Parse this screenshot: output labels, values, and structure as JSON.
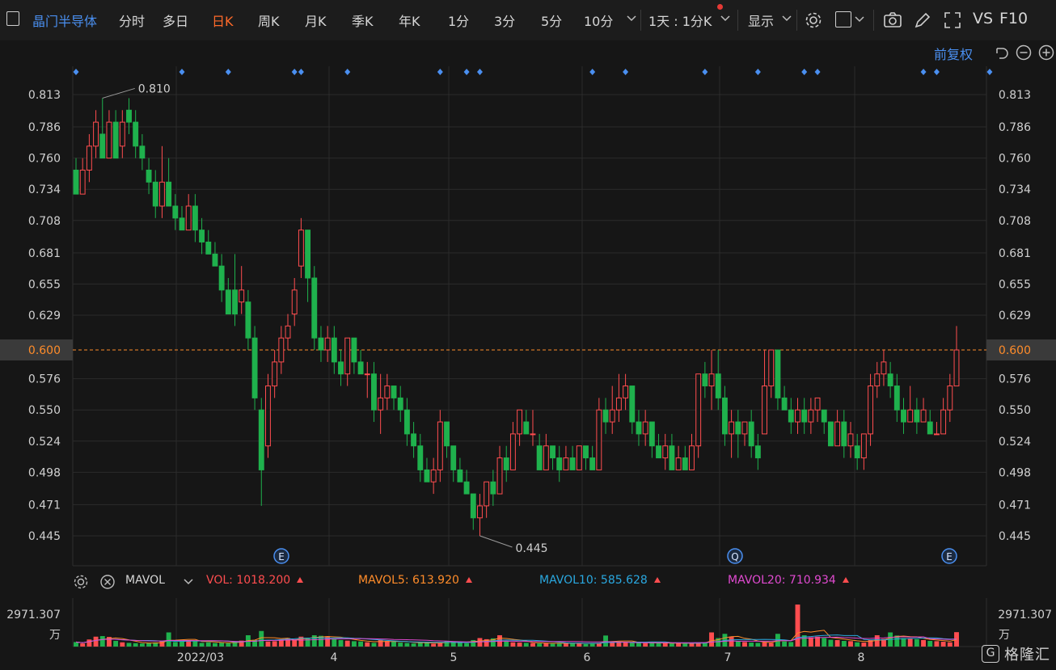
{
  "toolbar": {
    "stock_name": "晶门半导体",
    "periods": [
      "分时",
      "多日",
      "日K",
      "周K",
      "月K",
      "季K",
      "年K",
      "1分",
      "3分",
      "5分",
      "10分"
    ],
    "active_period": "日K",
    "interval_label": "1天 : 1分K",
    "display_label": "显示",
    "vs_label": "VS",
    "f10_label": "F10",
    "adjust_label": "前复权"
  },
  "volume_panel": {
    "indicator_label": "MAVOL",
    "vol": {
      "label": "VOL:",
      "value": "1018.200",
      "color": "#ff4d4f"
    },
    "mavol5": {
      "label": "MAVOL5:",
      "value": "613.920",
      "color": "#ff8c2a"
    },
    "mavol10": {
      "label": "MAVOL10:",
      "value": "585.628",
      "color": "#2aa8e0"
    },
    "mavol20": {
      "label": "MAVOL20:",
      "value": "710.934",
      "color": "#e04ad0"
    },
    "max_label": "2971.307",
    "unit_label": "万"
  },
  "brand": {
    "name": "格隆汇",
    "logo_letter": "G"
  },
  "colors": {
    "up": "#ff4d4f",
    "down": "#1fb14d",
    "grid": "#2b2b2b",
    "price_line": "#ff8c2a",
    "marker": "#4a8ff0",
    "accent": "#ff6a2a",
    "title": "#4a8ff0"
  },
  "chart_data": {
    "type": "candlestick",
    "y_ticks": [
      0.813,
      0.786,
      0.76,
      0.734,
      0.708,
      0.681,
      0.655,
      0.629,
      0.6,
      0.576,
      0.55,
      0.524,
      0.498,
      0.471,
      0.445
    ],
    "y_tick_labels": [
      "0.813",
      "0.786",
      "0.760",
      "0.734",
      "0.708",
      "0.681",
      "0.655",
      "0.629",
      "0.600",
      "0.576",
      "0.550",
      "0.524",
      "0.498",
      "0.471",
      "0.445"
    ],
    "ylim": [
      0.42,
      0.84
    ],
    "current_price": "0.600",
    "x_ticks": [
      "2022/03",
      "4",
      "5",
      "6",
      "7",
      "8"
    ],
    "high_label": "0.810",
    "low_label": "0.445",
    "high_value": 0.81,
    "low_value": 0.445,
    "event_markers": [
      "E",
      "E",
      "Q",
      "E"
    ],
    "candles": [
      [
        0.75,
        0.73,
        0.76,
        0.73
      ],
      [
        0.73,
        0.75,
        0.76,
        0.73
      ],
      [
        0.75,
        0.77,
        0.78,
        0.74
      ],
      [
        0.77,
        0.79,
        0.8,
        0.76
      ],
      [
        0.78,
        0.76,
        0.81,
        0.76
      ],
      [
        0.76,
        0.79,
        0.8,
        0.76
      ],
      [
        0.79,
        0.76,
        0.8,
        0.76
      ],
      [
        0.77,
        0.79,
        0.8,
        0.76
      ],
      [
        0.8,
        0.79,
        0.81,
        0.78
      ],
      [
        0.79,
        0.77,
        0.8,
        0.76
      ],
      [
        0.77,
        0.76,
        0.78,
        0.75
      ],
      [
        0.75,
        0.74,
        0.76,
        0.73
      ],
      [
        0.74,
        0.72,
        0.75,
        0.71
      ],
      [
        0.72,
        0.74,
        0.77,
        0.71
      ],
      [
        0.74,
        0.72,
        0.76,
        0.72
      ],
      [
        0.72,
        0.71,
        0.73,
        0.7
      ],
      [
        0.71,
        0.7,
        0.72,
        0.7
      ],
      [
        0.7,
        0.72,
        0.73,
        0.7
      ],
      [
        0.72,
        0.7,
        0.73,
        0.69
      ],
      [
        0.7,
        0.69,
        0.71,
        0.68
      ],
      [
        0.69,
        0.68,
        0.7,
        0.68
      ],
      [
        0.68,
        0.67,
        0.69,
        0.67
      ],
      [
        0.67,
        0.65,
        0.68,
        0.64
      ],
      [
        0.65,
        0.63,
        0.66,
        0.63
      ],
      [
        0.65,
        0.63,
        0.68,
        0.62
      ],
      [
        0.64,
        0.65,
        0.67,
        0.63
      ],
      [
        0.64,
        0.61,
        0.65,
        0.6
      ],
      [
        0.61,
        0.56,
        0.62,
        0.55
      ],
      [
        0.55,
        0.5,
        0.56,
        0.47
      ],
      [
        0.52,
        0.57,
        0.58,
        0.51
      ],
      [
        0.57,
        0.59,
        0.6,
        0.56
      ],
      [
        0.59,
        0.61,
        0.62,
        0.58
      ],
      [
        0.61,
        0.62,
        0.63,
        0.6
      ],
      [
        0.63,
        0.65,
        0.66,
        0.62
      ],
      [
        0.67,
        0.7,
        0.71,
        0.66
      ],
      [
        0.7,
        0.66,
        0.7,
        0.64
      ],
      [
        0.66,
        0.61,
        0.67,
        0.6
      ],
      [
        0.61,
        0.6,
        0.62,
        0.59
      ],
      [
        0.6,
        0.61,
        0.62,
        0.59
      ],
      [
        0.61,
        0.59,
        0.62,
        0.58
      ],
      [
        0.59,
        0.58,
        0.6,
        0.57
      ],
      [
        0.58,
        0.61,
        0.61,
        0.57
      ],
      [
        0.61,
        0.59,
        0.61,
        0.58
      ],
      [
        0.59,
        0.58,
        0.6,
        0.58
      ],
      [
        0.58,
        0.58,
        0.59,
        0.56
      ],
      [
        0.58,
        0.55,
        0.59,
        0.54
      ],
      [
        0.55,
        0.56,
        0.58,
        0.53
      ],
      [
        0.56,
        0.57,
        0.58,
        0.55
      ],
      [
        0.57,
        0.56,
        0.57,
        0.55
      ],
      [
        0.56,
        0.55,
        0.57,
        0.54
      ],
      [
        0.55,
        0.53,
        0.56,
        0.52
      ],
      [
        0.53,
        0.52,
        0.54,
        0.51
      ],
      [
        0.52,
        0.5,
        0.53,
        0.49
      ],
      [
        0.5,
        0.49,
        0.51,
        0.49
      ],
      [
        0.49,
        0.5,
        0.51,
        0.48
      ],
      [
        0.5,
        0.54,
        0.55,
        0.49
      ],
      [
        0.54,
        0.52,
        0.54,
        0.51
      ],
      [
        0.52,
        0.5,
        0.52,
        0.49
      ],
      [
        0.5,
        0.49,
        0.51,
        0.49
      ],
      [
        0.49,
        0.48,
        0.5,
        0.48
      ],
      [
        0.48,
        0.46,
        0.48,
        0.45
      ],
      [
        0.46,
        0.47,
        0.48,
        0.445
      ],
      [
        0.47,
        0.49,
        0.49,
        0.46
      ],
      [
        0.49,
        0.48,
        0.5,
        0.47
      ],
      [
        0.48,
        0.51,
        0.52,
        0.48
      ],
      [
        0.51,
        0.5,
        0.52,
        0.49
      ],
      [
        0.5,
        0.53,
        0.54,
        0.5
      ],
      [
        0.53,
        0.55,
        0.55,
        0.52
      ],
      [
        0.54,
        0.53,
        0.55,
        0.53
      ],
      [
        0.53,
        0.53,
        0.55,
        0.52
      ],
      [
        0.52,
        0.5,
        0.53,
        0.5
      ],
      [
        0.5,
        0.52,
        0.53,
        0.5
      ],
      [
        0.52,
        0.51,
        0.52,
        0.5
      ],
      [
        0.51,
        0.5,
        0.52,
        0.49
      ],
      [
        0.5,
        0.51,
        0.52,
        0.5
      ],
      [
        0.51,
        0.5,
        0.52,
        0.5
      ],
      [
        0.5,
        0.52,
        0.52,
        0.5
      ],
      [
        0.52,
        0.51,
        0.52,
        0.5
      ],
      [
        0.51,
        0.5,
        0.52,
        0.5
      ],
      [
        0.5,
        0.55,
        0.56,
        0.5
      ],
      [
        0.55,
        0.54,
        0.56,
        0.53
      ],
      [
        0.54,
        0.55,
        0.57,
        0.53
      ],
      [
        0.55,
        0.56,
        0.58,
        0.54
      ],
      [
        0.56,
        0.57,
        0.58,
        0.55
      ],
      [
        0.57,
        0.54,
        0.57,
        0.53
      ],
      [
        0.54,
        0.53,
        0.55,
        0.52
      ],
      [
        0.53,
        0.54,
        0.55,
        0.52
      ],
      [
        0.54,
        0.52,
        0.54,
        0.51
      ],
      [
        0.52,
        0.51,
        0.53,
        0.51
      ],
      [
        0.51,
        0.52,
        0.53,
        0.5
      ],
      [
        0.52,
        0.5,
        0.53,
        0.5
      ],
      [
        0.5,
        0.51,
        0.52,
        0.5
      ],
      [
        0.51,
        0.5,
        0.52,
        0.5
      ],
      [
        0.5,
        0.52,
        0.53,
        0.5
      ],
      [
        0.52,
        0.58,
        0.58,
        0.51
      ],
      [
        0.58,
        0.57,
        0.59,
        0.56
      ],
      [
        0.57,
        0.58,
        0.6,
        0.55
      ],
      [
        0.58,
        0.56,
        0.6,
        0.55
      ],
      [
        0.56,
        0.53,
        0.57,
        0.52
      ],
      [
        0.53,
        0.54,
        0.55,
        0.51
      ],
      [
        0.54,
        0.53,
        0.55,
        0.51
      ],
      [
        0.53,
        0.54,
        0.54,
        0.52
      ],
      [
        0.54,
        0.52,
        0.55,
        0.51
      ],
      [
        0.52,
        0.51,
        0.53,
        0.5
      ],
      [
        0.53,
        0.57,
        0.6,
        0.53
      ],
      [
        0.57,
        0.6,
        0.6,
        0.56
      ],
      [
        0.6,
        0.56,
        0.6,
        0.55
      ],
      [
        0.56,
        0.55,
        0.57,
        0.55
      ],
      [
        0.55,
        0.54,
        0.56,
        0.53
      ],
      [
        0.54,
        0.55,
        0.56,
        0.53
      ],
      [
        0.55,
        0.54,
        0.56,
        0.53
      ],
      [
        0.54,
        0.55,
        0.56,
        0.53
      ],
      [
        0.55,
        0.56,
        0.56,
        0.54
      ],
      [
        0.55,
        0.54,
        0.55,
        0.53
      ],
      [
        0.54,
        0.52,
        0.54,
        0.52
      ],
      [
        0.52,
        0.54,
        0.55,
        0.52
      ],
      [
        0.54,
        0.52,
        0.55,
        0.51
      ],
      [
        0.52,
        0.53,
        0.54,
        0.51
      ],
      [
        0.52,
        0.51,
        0.53,
        0.5
      ],
      [
        0.51,
        0.53,
        0.53,
        0.5
      ],
      [
        0.53,
        0.57,
        0.58,
        0.52
      ],
      [
        0.57,
        0.58,
        0.59,
        0.56
      ],
      [
        0.58,
        0.59,
        0.6,
        0.57
      ],
      [
        0.58,
        0.57,
        0.59,
        0.56
      ],
      [
        0.57,
        0.55,
        0.58,
        0.54
      ],
      [
        0.55,
        0.54,
        0.56,
        0.53
      ],
      [
        0.54,
        0.55,
        0.57,
        0.54
      ],
      [
        0.55,
        0.54,
        0.56,
        0.53
      ],
      [
        0.54,
        0.55,
        0.56,
        0.54
      ],
      [
        0.54,
        0.53,
        0.55,
        0.53
      ],
      [
        0.53,
        0.53,
        0.54,
        0.53
      ],
      [
        0.53,
        0.55,
        0.56,
        0.53
      ],
      [
        0.55,
        0.57,
        0.58,
        0.54
      ],
      [
        0.57,
        0.6,
        0.62,
        0.57
      ]
    ],
    "volumes": [
      320,
      220,
      500,
      700,
      740,
      680,
      400,
      300,
      260,
      240,
      220,
      250,
      300,
      400,
      1000,
      320,
      380,
      450,
      380,
      260,
      300,
      250,
      280,
      240,
      360,
      420,
      800,
      460,
      1100,
      360,
      380,
      520,
      600,
      480,
      700,
      600,
      800,
      760,
      720,
      560,
      460,
      420,
      380,
      360,
      300,
      260,
      480,
      400,
      360,
      280,
      250,
      220,
      300,
      280,
      200,
      260,
      400,
      360,
      320,
      240,
      460,
      600,
      520,
      580,
      800,
      360,
      300,
      280,
      260,
      240,
      220,
      240,
      200,
      260,
      260,
      220,
      200,
      180,
      240,
      260,
      780,
      300,
      320,
      300,
      280,
      260,
      240,
      260,
      240,
      280,
      220,
      240,
      200,
      260,
      280,
      300,
      1000,
      600,
      900,
      700,
      400,
      320,
      280,
      260,
      300,
      260,
      900,
      360,
      320,
      2971.307,
      800,
      660,
      700,
      600,
      480,
      460,
      400,
      380,
      300,
      280,
      460,
      800,
      540,
      1000,
      780,
      600,
      560,
      520,
      460,
      400,
      380,
      340,
      300,
      1018.2
    ]
  }
}
